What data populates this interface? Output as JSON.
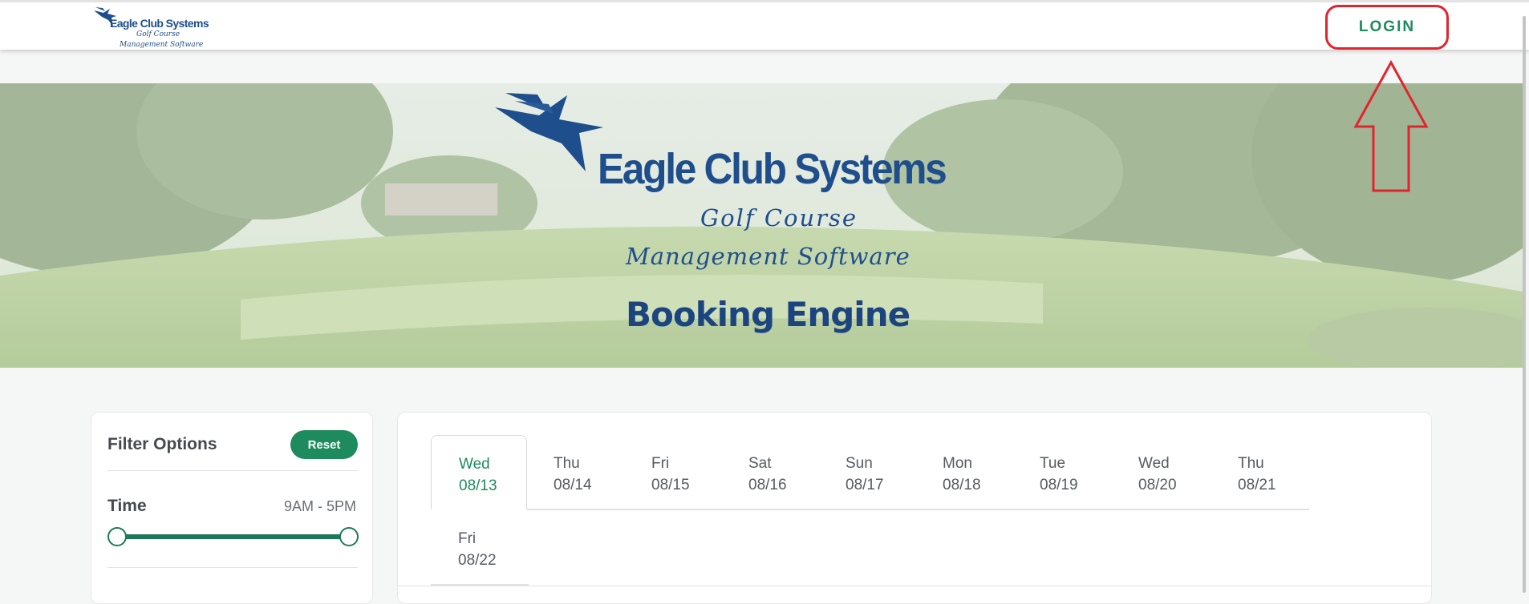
{
  "header": {
    "logo": {
      "brand": "Eagle Club Systems",
      "line2": "Golf Course",
      "line3": "Management Software"
    },
    "login_label": "LOGIN"
  },
  "hero": {
    "brand": "Eagle Club Systems",
    "line2": "Golf Course",
    "line3": "Management Software",
    "title": "Booking Engine"
  },
  "filters": {
    "title": "Filter Options",
    "reset_label": "Reset",
    "time_label": "Time",
    "time_range": "9AM - 5PM",
    "time_slider": {
      "start_fraction": 0.0,
      "end_fraction": 1.0
    }
  },
  "dates": {
    "selected_index": 0,
    "tabs": [
      {
        "day": "Wed",
        "date": "08/13"
      },
      {
        "day": "Thu",
        "date": "08/14"
      },
      {
        "day": "Fri",
        "date": "08/15"
      },
      {
        "day": "Sat",
        "date": "08/16"
      },
      {
        "day": "Sun",
        "date": "08/17"
      },
      {
        "day": "Mon",
        "date": "08/18"
      },
      {
        "day": "Tue",
        "date": "08/19"
      },
      {
        "day": "Wed",
        "date": "08/20"
      },
      {
        "day": "Thu",
        "date": "08/21"
      },
      {
        "day": "Fri",
        "date": "08/22"
      }
    ]
  },
  "colors": {
    "accent": "#1d8b5d",
    "brand_blue": "#1f4e8c",
    "annotation_red": "#e2242f"
  },
  "icons": [
    "eagle-logo-icon",
    "annotation-arrow-icon"
  ]
}
